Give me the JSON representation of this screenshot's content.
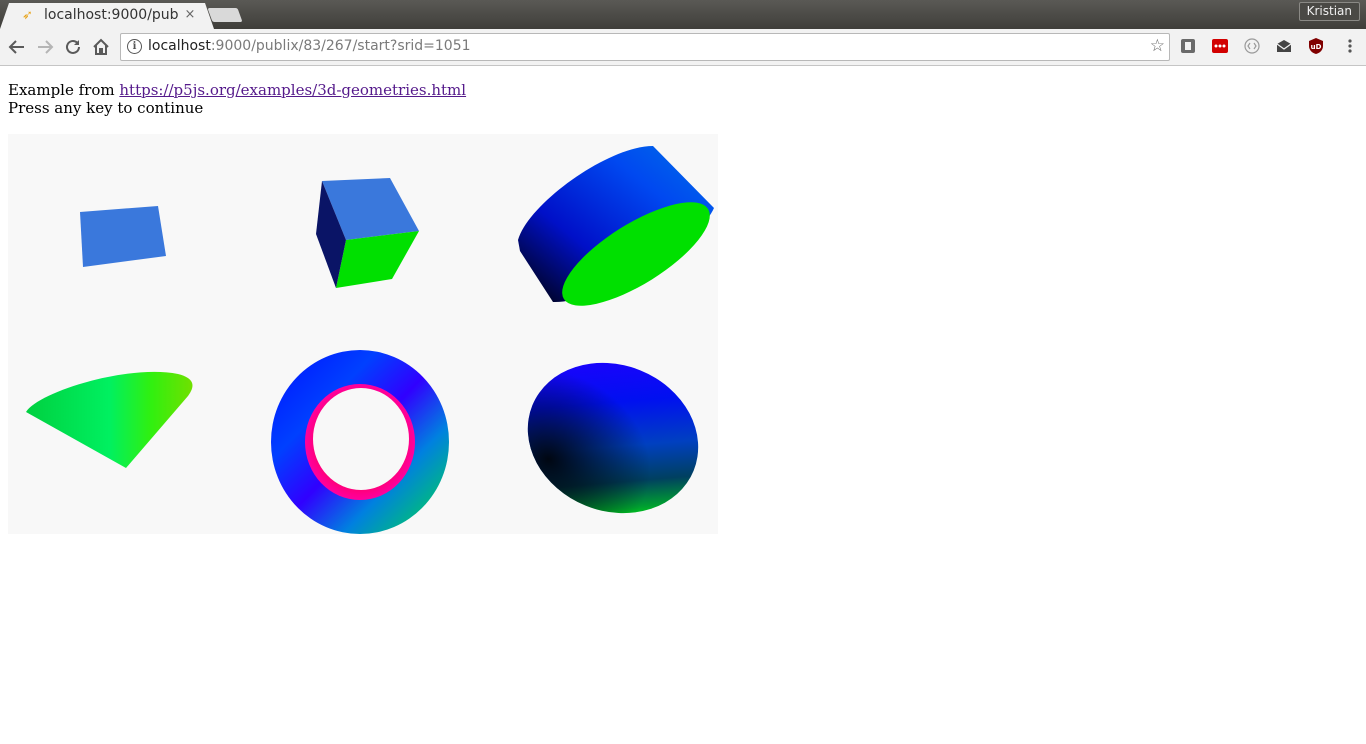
{
  "browser": {
    "tab_title": "localhost:9000/pub",
    "tab_close": "×",
    "profile_name": "Kristian",
    "url_host": "localhost",
    "url_rest": ":9000/publix/83/267/start?srid=1051"
  },
  "page": {
    "intro_text": "Example from ",
    "link_text": "https://p5js.org/examples/3d-geometries.html",
    "instruction": "Press any key to continue"
  },
  "colors": {
    "link": "#551a8b",
    "canvas_bg": "#f8f8f8",
    "plane": "#3a78dc",
    "cube_top": "#3a78dc",
    "cube_front": "#00e000",
    "cube_side": "#0a1466"
  },
  "icons": [
    "back-arrow-icon",
    "forward-arrow-icon",
    "reload-icon",
    "home-icon",
    "info-icon",
    "star-icon",
    "extension-icons",
    "menu-dots-icon"
  ]
}
